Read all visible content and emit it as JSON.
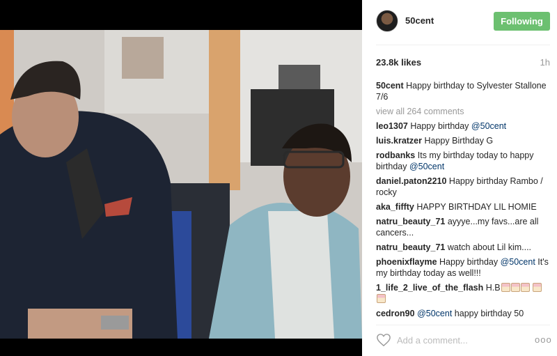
{
  "post": {
    "username": "50cent",
    "follow_label": "Following",
    "likes": "23.8k likes",
    "time": "1h",
    "caption": {
      "user": "50cent",
      "text": "Happy birthday to Sylvester Stallone 7/6"
    },
    "view_all": "view all 264 comments"
  },
  "comments": [
    {
      "user": "leo1307",
      "text": "Happy birthday ",
      "mention": "@50cent"
    },
    {
      "user": "luis.kratzer",
      "text": "Happy Birthday G"
    },
    {
      "user": "rodbanks",
      "text": "Its my birthday today to happy birthday ",
      "mention": "@50cent"
    },
    {
      "user": "daniel.paton2210",
      "text": "Happy birthday Rambo / rocky"
    },
    {
      "user": "aka_fiffty",
      "text": "HAPPY BIRTHDAY LIL HOMIE"
    },
    {
      "user": "natru_beauty_71",
      "text": "ayyye...my favs...are all cancers..."
    },
    {
      "user": "natru_beauty_71",
      "text": "watch about Lil kim...."
    },
    {
      "user": "phoenixflayme",
      "text": "Happy birthday ",
      "mention": "@50cent",
      "text2": " It's my birthday today as well!!!"
    },
    {
      "user": "1_life_2_live_of_the_flash",
      "text": "H.B"
    },
    {
      "user": "cedron90",
      "mention": "@50cent",
      "text2": " happy birthday 50"
    }
  ],
  "footer": {
    "comment_placeholder": "Add a comment...",
    "more_label": "ooo"
  },
  "icons": {
    "heart": "heart-icon",
    "cake": "birthday-cake-emoji"
  },
  "colors": {
    "follow_button": "#6cc070",
    "mention": "#003569",
    "muted": "#999999"
  }
}
